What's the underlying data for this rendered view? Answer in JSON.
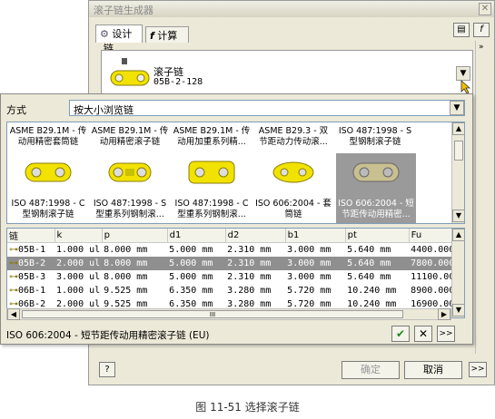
{
  "window": {
    "title": "滚子链生成器",
    "close_glyph": "✕"
  },
  "tabs": [
    {
      "label": "设计"
    },
    {
      "label": "计算"
    }
  ],
  "chain_group": {
    "label": "链",
    "name": "滚子链",
    "code": "05B-2-128"
  },
  "popup": {
    "method_label": "方式",
    "method_value": "按大小浏览链",
    "gallery_top": [
      {
        "line1": "ASME B29.1M - 传",
        "line2": "动用精密套筒链"
      },
      {
        "line1": "ASME B29.1M - 传",
        "line2": "动用精密滚子链"
      },
      {
        "line1": "ASME B29.1M - 传",
        "line2": "动用加重系列精..."
      },
      {
        "line1": "ASME B29.3 - 双",
        "line2": "节距动力传动滚..."
      },
      {
        "line1": "ISO 487:1998 - S",
        "line2": "型钢制滚子链"
      }
    ],
    "gallery_bottom": [
      {
        "line1": "ISO 487:1998 - C",
        "line2": "型钢制滚子链"
      },
      {
        "line1": "ISO 487:1998 - S",
        "line2": "型重系列钢制滚..."
      },
      {
        "line1": "ISO 487:1998 - C",
        "line2": "型重系列钢制滚..."
      },
      {
        "line1": "ISO 606:2004 - 套",
        "line2": "筒链"
      },
      {
        "line1": "ISO 606:2004 - 短",
        "line2": "节距传动用精密..."
      }
    ],
    "columns": [
      "链",
      "k",
      "p",
      "d1",
      "d2",
      "b1",
      "pt",
      "Fu"
    ],
    "rows": [
      {
        "c": [
          "05B-1",
          "1.000 ul",
          "8.000 mm",
          "5.000 mm",
          "2.310 mm",
          "3.000 mm",
          "5.640 mm",
          "4400.000"
        ],
        "selected": false
      },
      {
        "c": [
          "05B-2",
          "2.000 ul",
          "8.000 mm",
          "5.000 mm",
          "2.310 mm",
          "3.000 mm",
          "5.640 mm",
          "7800.000"
        ],
        "selected": true
      },
      {
        "c": [
          "05B-3",
          "3.000 ul",
          "8.000 mm",
          "5.000 mm",
          "2.310 mm",
          "3.000 mm",
          "5.640 mm",
          "11100.00"
        ],
        "selected": false
      },
      {
        "c": [
          "06B-1",
          "1.000 ul",
          "9.525 mm",
          "6.350 mm",
          "3.280 mm",
          "5.720 mm",
          "10.240 mm",
          "8900.000"
        ],
        "selected": false
      },
      {
        "c": [
          "06B-2",
          "2.000 ul",
          "9.525 mm",
          "6.350 mm",
          "3.280 mm",
          "5.720 mm",
          "10.240 mm",
          "16900.00"
        ],
        "selected": false
      }
    ],
    "status": "ISO 606:2004 - 短节距传动用精密滚子链 (EU)",
    "scroll_grip": "III"
  },
  "bottom": {
    "help": "?",
    "ok": "确定",
    "cancel": "取消",
    "more": ">>"
  },
  "caption": "图 11-51   选择滚子链",
  "colors": {
    "chain_yellow": "#f2e200",
    "chain_outline": "#8a7d00",
    "selected_row": "#8f8f8f",
    "ok_green": "#1a8a1a"
  }
}
